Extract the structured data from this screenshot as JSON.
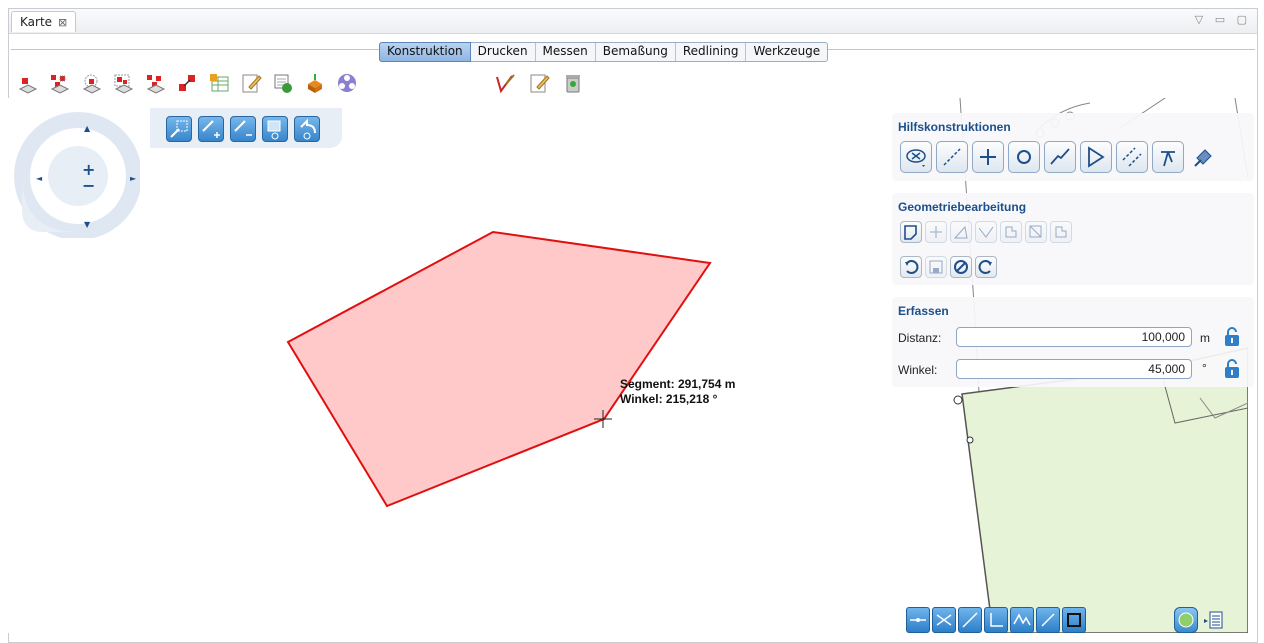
{
  "view_tab": {
    "title": "Karte",
    "close": "⊠"
  },
  "window_controls": "▽ ▭ ▢",
  "ribbon": {
    "tabs": [
      "Konstruktion",
      "Drucken",
      "Messen",
      "Bemaßung",
      "Redlining",
      "Werkzeuge"
    ],
    "active": "Konstruktion"
  },
  "colors": {
    "accent": "#2d7fc9",
    "polygon_fill": "#ffc9c9",
    "polygon_stroke": "#e01010",
    "parcel_fill": "#e6f3d6",
    "panel_title": "#1d4f8a"
  },
  "toolbar_icons": [
    "select-point-icon",
    "select-add-icon",
    "select-remove-icon",
    "select-rect-icon",
    "select-polygon-icon",
    "select-move-icon",
    "attribute-table-icon",
    "edit-attributes-icon",
    "layer-refresh-icon",
    "export-icon",
    "network-icon",
    "redline-edit-icon",
    "note-edit-icon",
    "recycle-bin-icon"
  ],
  "zoom_buttons": [
    "zoom-rect-icon",
    "zoom-in-icon",
    "zoom-out-icon",
    "zoom-extent-icon",
    "zoom-back-icon"
  ],
  "nav": {
    "up": "▲",
    "down": "▼",
    "left": "◄",
    "right": "►",
    "plus": "+",
    "minus": "−"
  },
  "panels": {
    "hilfskonstruktionen": {
      "title": "Hilfskonstruktionen",
      "icons": [
        "snap-off-icon",
        "line-icon",
        "point-icon",
        "circle-icon",
        "polyline-icon",
        "angle-icon",
        "parallel-icon",
        "perpendicular-icon",
        "satellite-icon"
      ]
    },
    "geometriebearbeitung": {
      "title": "Geometriebearbeitung",
      "icons_row1": [
        "polygon-edit-icon",
        "move-vertex-icon",
        "rotate-icon",
        "cut-icon",
        "merge-icon",
        "split-icon",
        "copy-icon"
      ],
      "icons_row2": [
        "undo-icon",
        "save-icon",
        "cancel-icon",
        "redo-icon"
      ]
    },
    "erfassen": {
      "title": "Erfassen",
      "distanz_label": "Distanz:",
      "distanz_value": "100,000",
      "distanz_unit": "m",
      "winkel_label": "Winkel:",
      "winkel_value": "45,000",
      "winkel_unit": "°"
    }
  },
  "map_tooltip": {
    "segment": "Segment: 291,754 m",
    "winkel": "Winkel: 215,218 °"
  },
  "bottom_tools": [
    "snap-vertex-icon",
    "snap-intersection-icon",
    "snap-line-icon",
    "snap-perpendicular-icon",
    "snap-midpoint-icon",
    "snap-tangent-icon",
    "snap-corner-icon",
    "globe-icon",
    "legend-icon"
  ]
}
